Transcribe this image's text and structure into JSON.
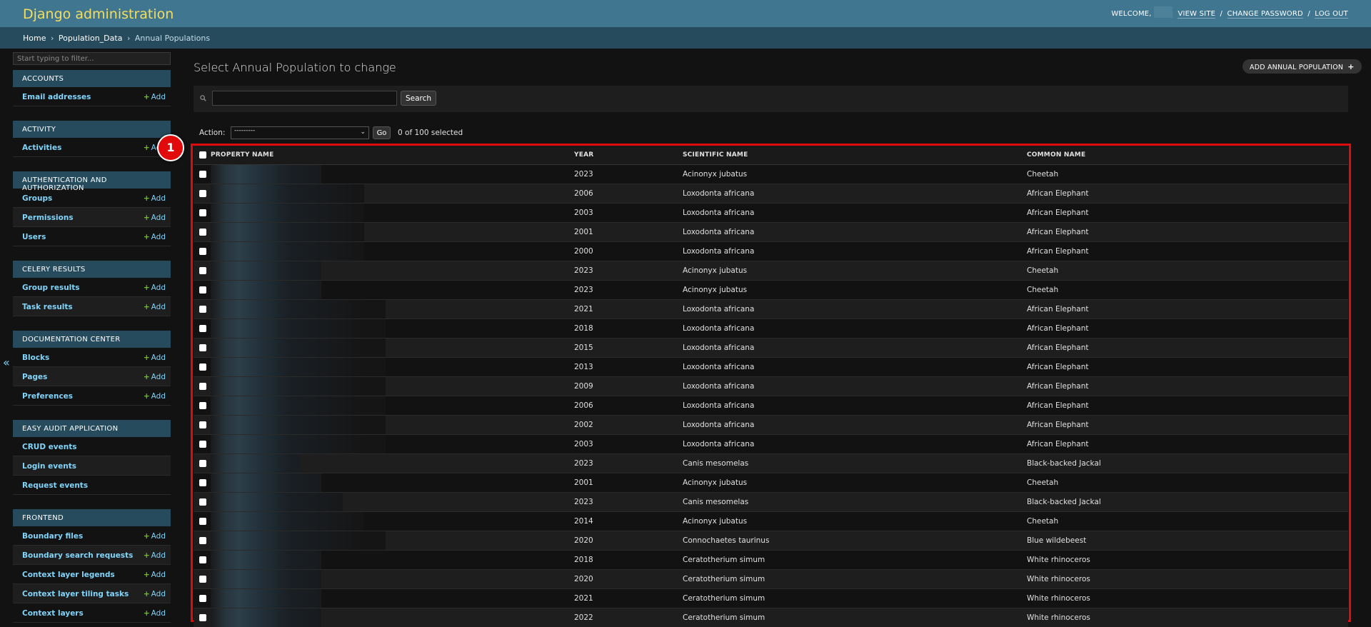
{
  "header": {
    "site_title": "Django administration",
    "welcome": "WELCOME,",
    "view_site": "VIEW SITE",
    "change_password": "CHANGE PASSWORD",
    "log_out": "LOG OUT",
    "separator": "/"
  },
  "breadcrumbs": {
    "home": "Home",
    "app": "Population_Data",
    "current": "Annual Populations",
    "sep": "›"
  },
  "sidebar": {
    "filter_placeholder": "Start typing to filter...",
    "collapse_icon": "«",
    "add_label": "Add",
    "apps": [
      {
        "name": "ACCOUNTS",
        "models": [
          {
            "name": "Email addresses",
            "add": true
          }
        ]
      },
      {
        "name": "ACTIVITY",
        "models": [
          {
            "name": "Activities",
            "add": true
          }
        ]
      },
      {
        "name": "AUTHENTICATION AND AUTHORIZATION",
        "models": [
          {
            "name": "Groups",
            "add": true
          },
          {
            "name": "Permissions",
            "add": true
          },
          {
            "name": "Users",
            "add": true
          }
        ]
      },
      {
        "name": "CELERY RESULTS",
        "models": [
          {
            "name": "Group results",
            "add": true
          },
          {
            "name": "Task results",
            "add": true
          }
        ]
      },
      {
        "name": "DOCUMENTATION CENTER",
        "models": [
          {
            "name": "Blocks",
            "add": true
          },
          {
            "name": "Pages",
            "add": true
          },
          {
            "name": "Preferences",
            "add": true
          }
        ]
      },
      {
        "name": "EASY AUDIT APPLICATION",
        "models": [
          {
            "name": "CRUD events",
            "add": false
          },
          {
            "name": "Login events",
            "add": false
          },
          {
            "name": "Request events",
            "add": false
          }
        ]
      },
      {
        "name": "FRONTEND",
        "models": [
          {
            "name": "Boundary files",
            "add": true
          },
          {
            "name": "Boundary search requests",
            "add": true
          },
          {
            "name": "Context layer legends",
            "add": true
          },
          {
            "name": "Context layer tiling tasks",
            "add": true
          },
          {
            "name": "Context layers",
            "add": true
          }
        ]
      }
    ]
  },
  "content": {
    "title": "Select Annual Population to change",
    "add_button": "ADD ANNUAL POPULATION",
    "add_icon": "+",
    "search_button": "Search",
    "search_value": "",
    "action_label": "Action:",
    "action_selected": "---------",
    "go_button": "Go",
    "selected_count": "0 of 100 selected"
  },
  "table": {
    "headers": [
      "PROPERTY NAME",
      "YEAR",
      "SCIENTIFIC NAME",
      "COMMON NAME"
    ],
    "rows": [
      {
        "year": "2023",
        "sci": "Acinonyx jubatus",
        "common": "Cheetah",
        "redact": 0.35
      },
      {
        "year": "2006",
        "sci": "Loxodonta africana",
        "common": "African Elephant",
        "redact": 0.55
      },
      {
        "year": "2003",
        "sci": "Loxodonta africana",
        "common": "African Elephant",
        "redact": 0.55
      },
      {
        "year": "2001",
        "sci": "Loxodonta africana",
        "common": "African Elephant",
        "redact": 0.55
      },
      {
        "year": "2000",
        "sci": "Loxodonta africana",
        "common": "African Elephant",
        "redact": 0.55
      },
      {
        "year": "2023",
        "sci": "Acinonyx jubatus",
        "common": "Cheetah",
        "redact": 0.35
      },
      {
        "year": "2023",
        "sci": "Acinonyx jubatus",
        "common": "Cheetah",
        "redact": 0.35
      },
      {
        "year": "2021",
        "sci": "Loxodonta africana",
        "common": "African Elephant",
        "redact": 0.65
      },
      {
        "year": "2018",
        "sci": "Loxodonta africana",
        "common": "African Elephant",
        "redact": 0.65
      },
      {
        "year": "2015",
        "sci": "Loxodonta africana",
        "common": "African Elephant",
        "redact": 0.65
      },
      {
        "year": "2013",
        "sci": "Loxodonta africana",
        "common": "African Elephant",
        "redact": 0.65
      },
      {
        "year": "2009",
        "sci": "Loxodonta africana",
        "common": "African Elephant",
        "redact": 0.65
      },
      {
        "year": "2006",
        "sci": "Loxodonta africana",
        "common": "African Elephant",
        "redact": 0.65
      },
      {
        "year": "2002",
        "sci": "Loxodonta africana",
        "common": "African Elephant",
        "redact": 0.65
      },
      {
        "year": "2003",
        "sci": "Loxodonta africana",
        "common": "African Elephant",
        "redact": 0.65
      },
      {
        "year": "2023",
        "sci": "Canis mesomelas",
        "common": "Black-backed Jackal",
        "redact": 0.25
      },
      {
        "year": "2001",
        "sci": "Acinonyx jubatus",
        "common": "Cheetah",
        "redact": 0.35
      },
      {
        "year": "2023",
        "sci": "Canis mesomelas",
        "common": "Black-backed Jackal",
        "redact": 0.45
      },
      {
        "year": "2014",
        "sci": "Acinonyx jubatus",
        "common": "Cheetah",
        "redact": 0.55
      },
      {
        "year": "2020",
        "sci": "Connochaetes taurinus",
        "common": "Blue wildebeest",
        "redact": 0.65
      },
      {
        "year": "2018",
        "sci": "Ceratotherium simum",
        "common": "White rhinoceros",
        "redact": 0.35
      },
      {
        "year": "2020",
        "sci": "Ceratotherium simum",
        "common": "White rhinoceros",
        "redact": 0.35
      },
      {
        "year": "2021",
        "sci": "Ceratotherium simum",
        "common": "White rhinoceros",
        "redact": 0.35
      },
      {
        "year": "2022",
        "sci": "Ceratotherium simum",
        "common": "White rhinoceros",
        "redact": 0.35
      }
    ]
  },
  "annotation": {
    "marker_label": "1"
  },
  "colors": {
    "header_bg": "#417690",
    "site_title": "#f5dd5d",
    "breadcrumbs_bg": "#264b5d",
    "link": "#81d4fa",
    "add_plus": "#70bf2b",
    "highlight": "#e10b0b"
  }
}
